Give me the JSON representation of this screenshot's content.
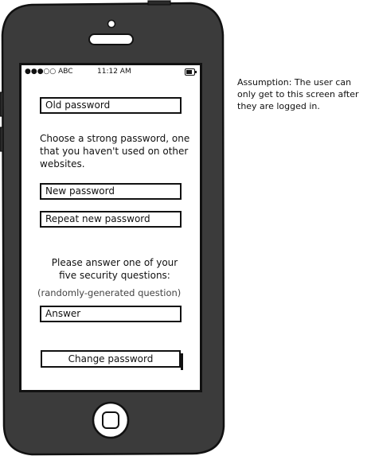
{
  "status_bar": {
    "carrier": "●●●○○ ABC",
    "time": "11:12 AM",
    "battery_icon": "battery-icon"
  },
  "form": {
    "old_password_placeholder": "Old password",
    "guidance": "Choose a strong password, one that you haven't used on other websites.",
    "new_password_placeholder": "New password",
    "repeat_password_placeholder": "Repeat new password",
    "security_prompt": "Please answer one of your five security questions:",
    "security_question": "(randomly-generated question)",
    "answer_placeholder": "Answer",
    "submit_label": "Change password"
  },
  "annotation": {
    "text": "Assumption: The user can only get to this screen after they are logged in."
  }
}
